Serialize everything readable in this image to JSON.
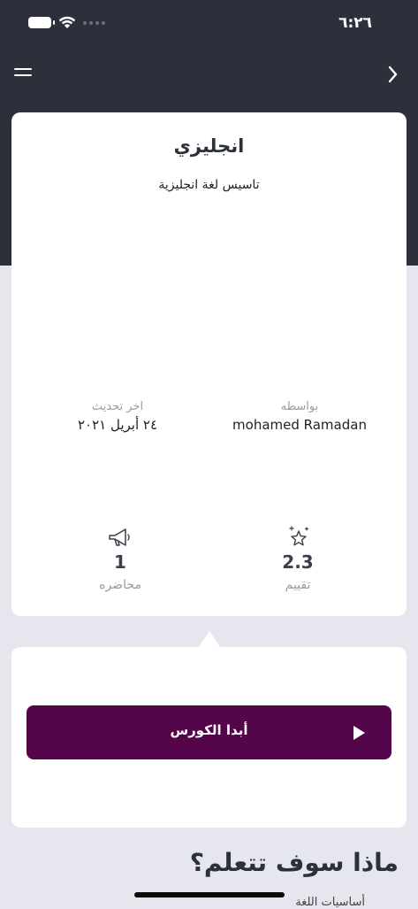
{
  "status_bar": {
    "time": "٦:٢٦"
  },
  "course": {
    "title": "انجليزي",
    "subtitle": "تاسيس لغة انجليزية",
    "author_label": "بواسطه",
    "author_name": "mohamed Ramadan",
    "updated_label": "اخر تحديث",
    "updated_date": "٢٤ أبريل ٢٠٢١",
    "rating_value": "2.3",
    "rating_label": "تقييم",
    "lectures_value": "1",
    "lectures_label": "محاضره"
  },
  "actions": {
    "start_label": "أبدا الكورس"
  },
  "section": {
    "heading": "ماذا سوف تتعلم؟",
    "partial_item": "أساسيات اللغة"
  },
  "colors": {
    "header_bg": "#2b303b",
    "page_bg": "#e6e6ee",
    "accent": "#55054a"
  },
  "icons": {
    "menu": "menu-icon",
    "back": "chevron-right-icon",
    "rating": "sparkle-star-icon",
    "lectures": "megaphone-icon",
    "play": "play-icon"
  }
}
